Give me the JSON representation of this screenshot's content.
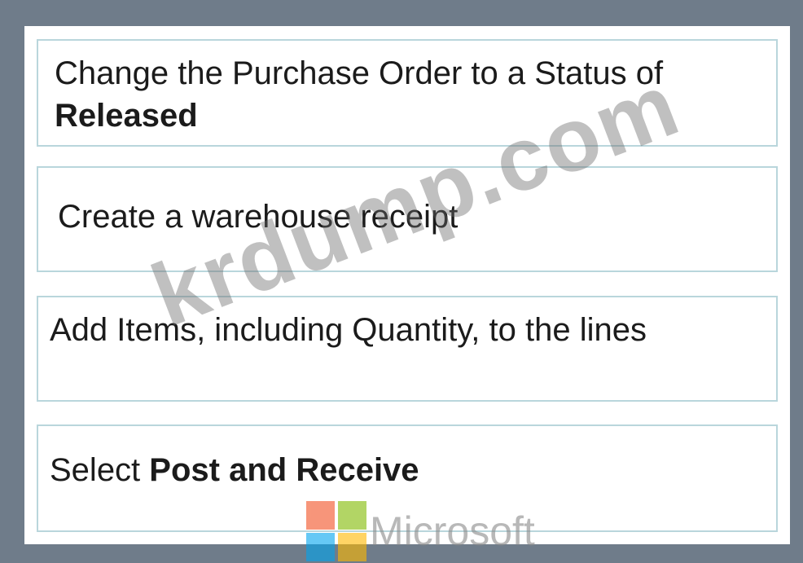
{
  "steps": [
    {
      "pre": "Change the Purchase Order to a Status of ",
      "bold": "Released",
      "post": ""
    },
    {
      "pre": "Create a warehouse receipt",
      "bold": "",
      "post": ""
    },
    {
      "pre": "Add Items, including Quantity, to the lines",
      "bold": "",
      "post": ""
    },
    {
      "pre": "Select ",
      "bold": "Post and Receive",
      "post": ""
    }
  ],
  "watermark": "krdump.com",
  "logo": {
    "word": "Microsoft",
    "colors": [
      "#f25022",
      "#7fba00",
      "#00a4ef",
      "#ffb900"
    ]
  },
  "colors": {
    "background": "#6f7c8a",
    "panel": "#ffffff",
    "step_border": "#b9d6dc"
  }
}
